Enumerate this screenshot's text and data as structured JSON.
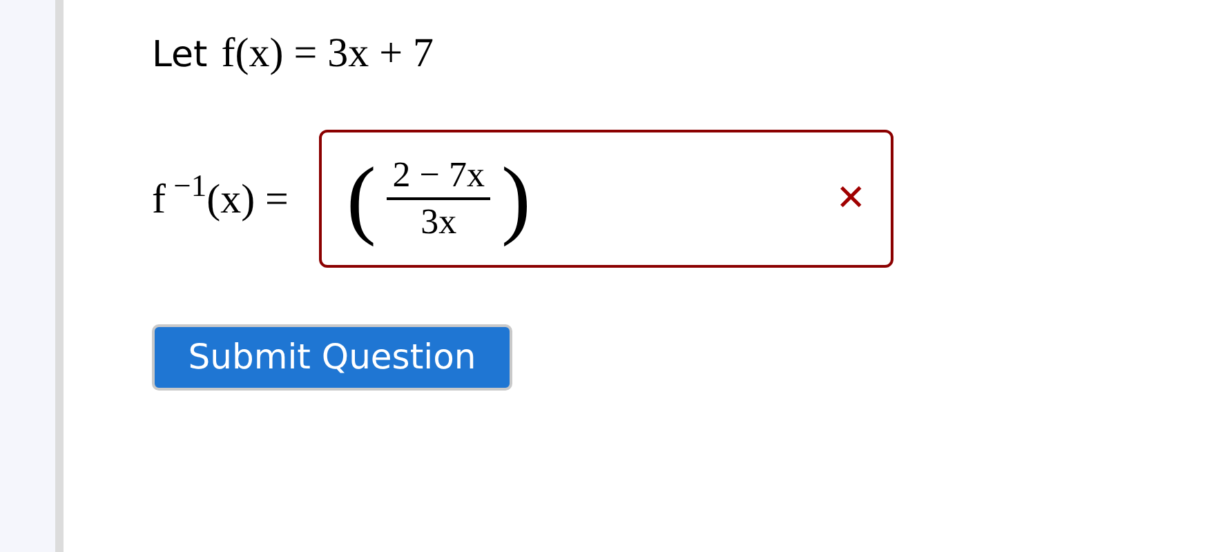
{
  "question": {
    "intro": "Let",
    "definition": "f(x) = 3x + 7"
  },
  "answer": {
    "lhs": "f$^{ −1}$(x) =",
    "open_paren": "(",
    "numerator": "2 − 7x",
    "denominator": "3x",
    "close_paren": ")",
    "correct": false,
    "feedback_mark": "✕"
  },
  "submit_button": "Submit Question"
}
